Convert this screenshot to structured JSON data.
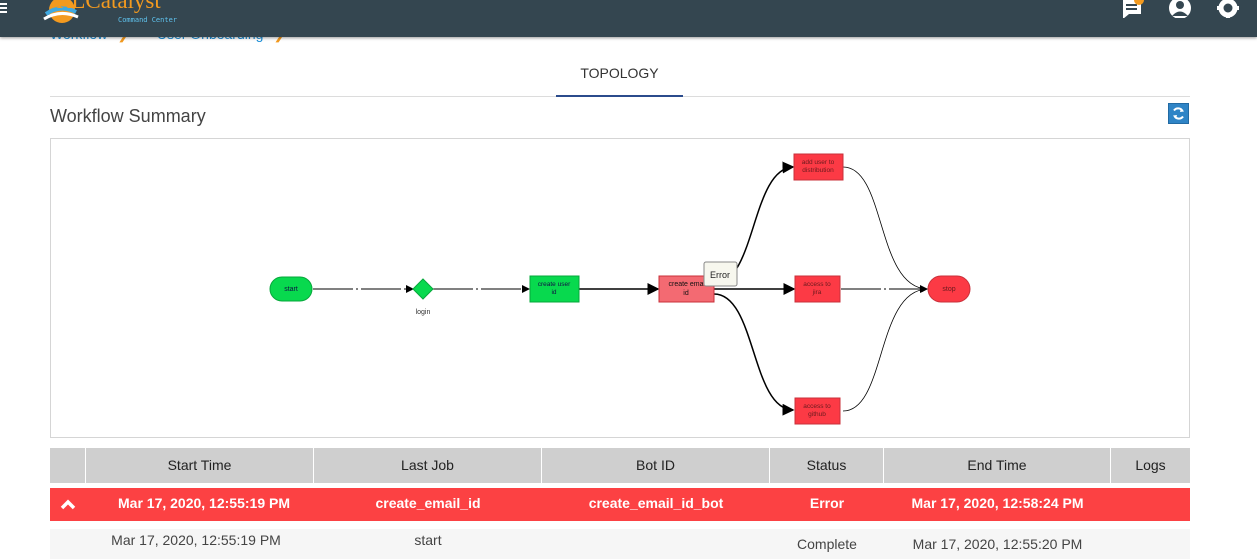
{
  "header": {
    "logo_text": "RLCatalyst",
    "logo_subtitle": "Command Center",
    "icons": [
      "menu-icon",
      "chat-icon",
      "user-icon",
      "gear-icon"
    ]
  },
  "breadcrumb": {
    "items": [
      "Workflow",
      "User Onboarding"
    ]
  },
  "tabs": [
    {
      "label": "TOPOLOGY",
      "active": true
    }
  ],
  "summary": {
    "title": "Workflow Summary",
    "refresh_icon": "refresh-icon"
  },
  "topology": {
    "nodes": [
      {
        "id": "start",
        "label": "start",
        "shape": "rounded",
        "status": "success"
      },
      {
        "id": "login",
        "label": "login",
        "shape": "diamond",
        "status": "success"
      },
      {
        "id": "create_user",
        "label": "create user id",
        "shape": "rect",
        "status": "success"
      },
      {
        "id": "create_email",
        "label": "create email id",
        "shape": "rect",
        "status": "error"
      },
      {
        "id": "add_user_dist",
        "label": "add user to distribution",
        "shape": "rect",
        "status": "error"
      },
      {
        "id": "access_jira",
        "label": "access to jira",
        "shape": "rect",
        "status": "error"
      },
      {
        "id": "access_github",
        "label": "access to github",
        "shape": "rect",
        "status": "error"
      },
      {
        "id": "stop",
        "label": "stop",
        "shape": "rounded",
        "status": "error"
      }
    ],
    "tooltip": "Error",
    "colors": {
      "success": "#08d94e",
      "error": "#fc3a45",
      "error_light": "#f36a72"
    }
  },
  "table": {
    "headers": [
      "",
      "Start Time",
      "Last Job",
      "Bot ID",
      "Status",
      "End Time",
      "Logs"
    ],
    "rows": [
      {
        "start_time": "Mar 17, 2020, 12:55:19 PM",
        "last_job": "create_email_id",
        "bot_id": "create_email_id_bot",
        "status": "Error",
        "end_time": "Mar 17, 2020, 12:58:24 PM",
        "logs": ""
      }
    ],
    "sub_rows": [
      {
        "start_time": "Mar 17, 2020, 12:55:19 PM",
        "last_job": "start",
        "bot_id": "",
        "status": "Complete",
        "end_time": "Mar 17, 2020, 12:55:20 PM"
      }
    ],
    "expand_icon": "chevron-up-icon"
  }
}
